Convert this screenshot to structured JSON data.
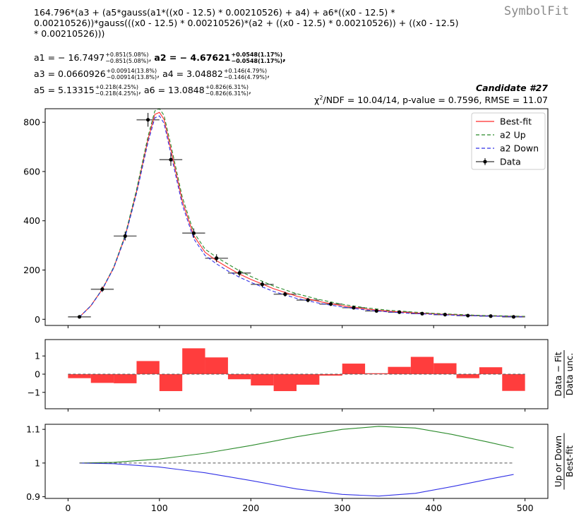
{
  "header": {
    "expression": "164.796*(a3 + (a5*gauss(a1*((x0 - 12.5) * 0.00210526) + a4) + a6*((x0 - 12.5) *\n0.00210526))*gauss(((x0 - 12.5) * 0.00210526)*(a2 + ((x0 - 12.5) * 0.00210526)) + ((x0 - 12.5)\n* 0.00210526)))",
    "brand": "SymbolFit",
    "candidate": "Candidate #27",
    "stats_prefix": "χ",
    "stats_sup": "2",
    "stats_rest": "/NDF = 10.04/14, p-value = 0.7596, RMSE = 11.07"
  },
  "params": [
    {
      "name": "a1",
      "value": "− 16.7497",
      "err_up": "+0.851(5.08%)",
      "err_down": "−0.851(5.08%)",
      "bold": false
    },
    {
      "name": "a2",
      "value": "− 4.67621",
      "err_up": "+0.0548(1.17%)",
      "err_down": "−0.0548(1.17%)",
      "bold": true
    },
    {
      "name": "a3",
      "value": "0.0660926",
      "err_up": "+0.00914(13.8%)",
      "err_down": "−0.00914(13.8%)",
      "bold": false
    },
    {
      "name": "a4",
      "value": "3.04882",
      "err_up": "+0.146(4.79%)",
      "err_down": "−0.146(4.79%)",
      "bold": false
    },
    {
      "name": "a5",
      "value": "5.13315",
      "err_up": "+0.218(4.25%)",
      "err_down": "−0.218(4.25%)",
      "bold": false
    },
    {
      "name": "a6",
      "value": "13.0848",
      "err_up": "+0.826(6.31%)",
      "err_down": "−0.826(6.31%)",
      "bold": false
    }
  ],
  "colors": {
    "best_fit": "#ff2a2a",
    "up": "#2a8a2a",
    "down": "#3232e6",
    "data": "#000000",
    "residual": "#ff3333"
  },
  "chart_data": [
    {
      "type": "line",
      "panel": "main",
      "xlim": [
        -25,
        525
      ],
      "ylim": [
        -25,
        855
      ],
      "xticks": [
        0,
        100,
        200,
        300,
        400,
        500
      ],
      "yticks": [
        0,
        200,
        400,
        600,
        800
      ],
      "legend": {
        "placement": "top-right",
        "entries": [
          "Best-fit",
          "a2 Up",
          "a2 Down",
          "Data"
        ]
      },
      "data": {
        "name": "Data",
        "x": [
          12.5,
          37.5,
          62.5,
          87.5,
          112.5,
          137.5,
          162.5,
          187.5,
          212.5,
          237.5,
          262.5,
          287.5,
          312.5,
          337.5,
          362.5,
          387.5,
          412.5,
          437.5,
          462.5,
          487.5
        ],
        "y": [
          10,
          122,
          338,
          810,
          648,
          350,
          248,
          188,
          142,
          102,
          78,
          62,
          47,
          34,
          29,
          23,
          19,
          15,
          13,
          10
        ],
        "xerr": 12.5,
        "yerr": [
          3,
          11,
          18,
          28,
          25,
          19,
          16,
          14,
          12,
          10,
          9,
          8,
          7,
          6,
          5,
          5,
          4,
          4,
          4,
          3
        ]
      },
      "series": [
        {
          "name": "Best-fit",
          "x": [
            12.5,
            25,
            37.5,
            50,
            62.5,
            75,
            87.5,
            95,
            100,
            105,
            112.5,
            125,
            137.5,
            150,
            162.5,
            175,
            187.5,
            200,
            225,
            250,
            275,
            300,
            325,
            350,
            375,
            400,
            425,
            450,
            475,
            500
          ],
          "y": [
            9,
            55,
            122,
            210,
            338,
            520,
            730,
            832,
            840,
            812,
            690,
            480,
            340,
            272,
            238,
            210,
            184,
            162,
            124,
            94,
            72,
            55,
            42,
            33,
            27,
            22,
            18,
            15,
            13,
            11
          ]
        },
        {
          "name": "a2 Up",
          "x": [
            12.5,
            25,
            37.5,
            50,
            62.5,
            75,
            87.5,
            95,
            100,
            105,
            112.5,
            125,
            137.5,
            150,
            162.5,
            175,
            187.5,
            200,
            225,
            250,
            275,
            300,
            325,
            350,
            375,
            400,
            425,
            450,
            475,
            500
          ],
          "y": [
            9,
            55,
            123,
            212,
            342,
            528,
            742,
            846,
            855,
            828,
            708,
            496,
            353,
            285,
            252,
            224,
            197,
            174,
            135,
            104,
            80,
            61,
            47,
            37,
            30,
            24,
            20,
            16,
            14,
            12
          ]
        },
        {
          "name": "a2 Down",
          "x": [
            12.5,
            25,
            37.5,
            50,
            62.5,
            75,
            87.5,
            95,
            100,
            105,
            112.5,
            125,
            137.5,
            150,
            162.5,
            175,
            187.5,
            200,
            225,
            250,
            275,
            300,
            325,
            350,
            375,
            400,
            425,
            450,
            475,
            500
          ],
          "y": [
            9,
            54,
            121,
            208,
            334,
            512,
            718,
            818,
            826,
            796,
            672,
            465,
            327,
            259,
            225,
            196,
            171,
            150,
            113,
            85,
            65,
            50,
            38,
            30,
            24,
            20,
            16,
            14,
            12,
            10
          ]
        }
      ]
    },
    {
      "type": "bar",
      "panel": "residual",
      "ylabel": "Data − Fit / Data unc.",
      "xlim": [
        -25,
        525
      ],
      "ylim": [
        -1.9,
        1.9
      ],
      "yticks": [
        -1,
        0,
        1
      ],
      "edges": [
        0,
        25,
        50,
        75,
        100,
        125,
        150,
        175,
        200,
        225,
        250,
        275,
        300,
        325,
        350,
        375,
        400,
        425,
        450,
        475,
        500
      ],
      "values": [
        -0.22,
        -0.48,
        -0.5,
        0.72,
        -0.93,
        1.42,
        0.92,
        -0.28,
        -0.62,
        -0.93,
        -0.58,
        -0.08,
        0.58,
        0.05,
        0.4,
        0.95,
        0.6,
        -0.22,
        0.38,
        -0.92
      ]
    },
    {
      "type": "line",
      "panel": "ratio",
      "ylabel": "Up or Down / Best-fit",
      "xlim": [
        -25,
        525
      ],
      "ylim": [
        0.895,
        1.115
      ],
      "yticks": [
        0.9,
        1,
        1.1
      ],
      "ytick_labels": [
        "0.9",
        "1",
        "1.1"
      ],
      "xticks": [
        0,
        100,
        200,
        300,
        400,
        500
      ],
      "series": [
        {
          "name": "Up / Best-fit",
          "x": [
            12.5,
            50,
            100,
            150,
            200,
            250,
            300,
            340,
            380,
            420,
            460,
            487.5
          ],
          "y": [
            1.0,
            1.002,
            1.012,
            1.029,
            1.052,
            1.078,
            1.1,
            1.109,
            1.104,
            1.085,
            1.062,
            1.045
          ]
        },
        {
          "name": "Down / Best-fit",
          "x": [
            12.5,
            50,
            100,
            150,
            200,
            250,
            300,
            340,
            380,
            420,
            460,
            487.5
          ],
          "y": [
            1.0,
            0.998,
            0.988,
            0.971,
            0.948,
            0.923,
            0.907,
            0.902,
            0.91,
            0.93,
            0.952,
            0.966
          ]
        },
        {
          "name": "Unity",
          "x": [
            12.5,
            487.5
          ],
          "y": [
            1,
            1
          ]
        }
      ]
    }
  ]
}
